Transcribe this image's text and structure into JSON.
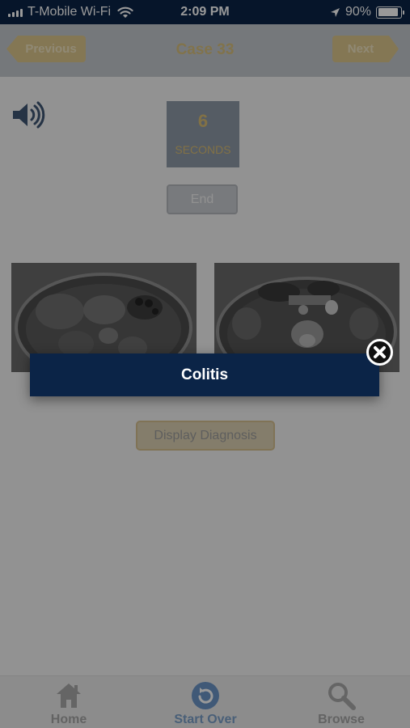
{
  "status_bar": {
    "carrier": "T-Mobile Wi-Fi",
    "time": "2:09 PM",
    "battery": "90%",
    "battery_level": 0.9
  },
  "nav": {
    "previous_label": "Previous",
    "title": "Case 33",
    "next_label": "Next"
  },
  "timer": {
    "value": "6",
    "unit_label": "SECONDS"
  },
  "end_label": "End",
  "display_diagnosis_label": "Display Diagnosis",
  "popup": {
    "diagnosis": "Colitis"
  },
  "tabs": [
    {
      "label": "Home",
      "icon": "home-icon"
    },
    {
      "label": "Start Over",
      "icon": "restart-icon"
    },
    {
      "label": "Browse",
      "icon": "search-icon"
    }
  ],
  "colors": {
    "navy": "#0b2447",
    "gold": "#d9bd74",
    "active_tab": "#7b9fc8"
  }
}
